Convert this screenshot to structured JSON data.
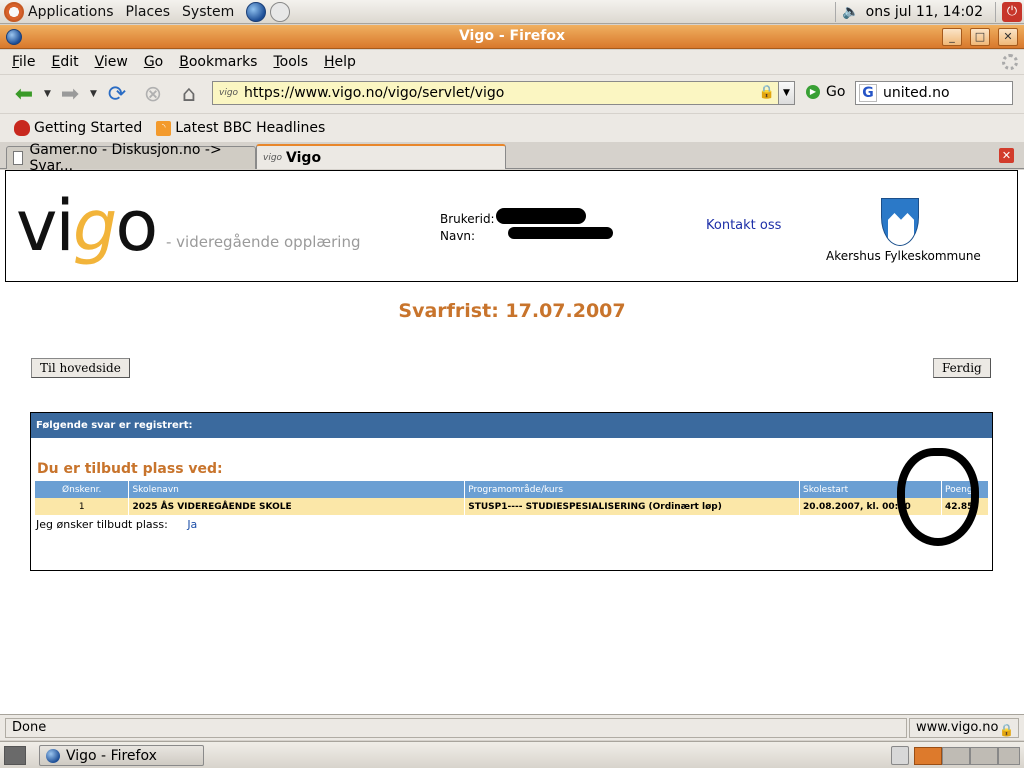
{
  "top_panel": {
    "menus": [
      "Applications",
      "Places",
      "System"
    ],
    "clock": "ons jul 11, 14:02"
  },
  "window": {
    "title": "Vigo - Firefox"
  },
  "menubar": [
    "File",
    "Edit",
    "View",
    "Go",
    "Bookmarks",
    "Tools",
    "Help"
  ],
  "navbar": {
    "url_favicon": "vigo",
    "url": "https://www.vigo.no/vigo/servlet/vigo",
    "go_label": "Go",
    "search_value": "united.no"
  },
  "bookmarks": [
    "Getting Started",
    "Latest BBC Headlines"
  ],
  "tabs": [
    {
      "label": "Gamer.no - Diskusjon.no -> Svar..."
    },
    {
      "label": "Vigo",
      "favicon": "vigo"
    }
  ],
  "page": {
    "logo_vi": "vi",
    "logo_g": "g",
    "logo_o": "o",
    "logo_sub": "- videregående opplæring",
    "user_id_label": "Brukerid:",
    "name_label": "Navn:",
    "contact_link": "Kontakt oss",
    "county": "Akershus Fylkeskommune",
    "deadline": "Svarfrist: 17.07.2007",
    "home_button": "Til hovedside",
    "done_button": "Ferdig",
    "result_header": "Følgende svar er registrert:",
    "offer_title": "Du er tilbudt plass ved:",
    "table": {
      "headers": [
        "Ønskenr.",
        "Skolenavn",
        "Programområde/kurs",
        "Skolestart",
        "Poeng"
      ],
      "rows": [
        [
          "1",
          "2025 ÅS VIDEREGÅENDE SKOLE",
          "STUSP1---- STUDIESPESIALISERING (Ordinært løp)",
          "20.08.2007, kl. 00:00",
          "42.85"
        ]
      ]
    },
    "wish_label": "Jeg ønsker tilbudt plass:",
    "wish_answer": "Ja"
  },
  "statusbar": {
    "status": "Done",
    "domain": "www.vigo.no"
  },
  "taskbar": {
    "window_button": "Vigo - Firefox"
  }
}
